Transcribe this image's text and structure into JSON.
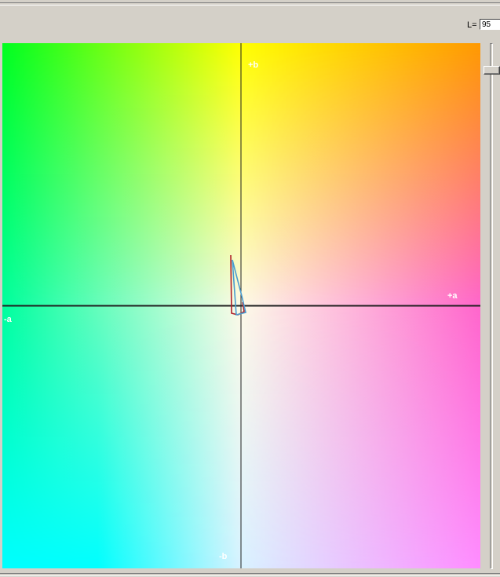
{
  "lightness": {
    "label": "L=",
    "value": "95"
  },
  "axes": {
    "positive_b": "+b",
    "negative_b": "-b",
    "positive_a": "+a",
    "negative_a": "-a"
  },
  "colors": {
    "plot_top_left": "#00ff20",
    "plot_top_center": "#ffff00",
    "plot_top_right": "#ff9900",
    "plot_middle_left": "#00ff9e",
    "plot_center": "#fdfae8",
    "plot_middle_right": "#ff66cc",
    "plot_bottom_left": "#00ffff",
    "plot_bottom_center": "#d8f2ff",
    "plot_bottom_right": "#ff8cff",
    "axis_line": "#202020",
    "gamut_outline_red": "#b0202a",
    "gamut_outline_blue": "#4a9cd0"
  }
}
